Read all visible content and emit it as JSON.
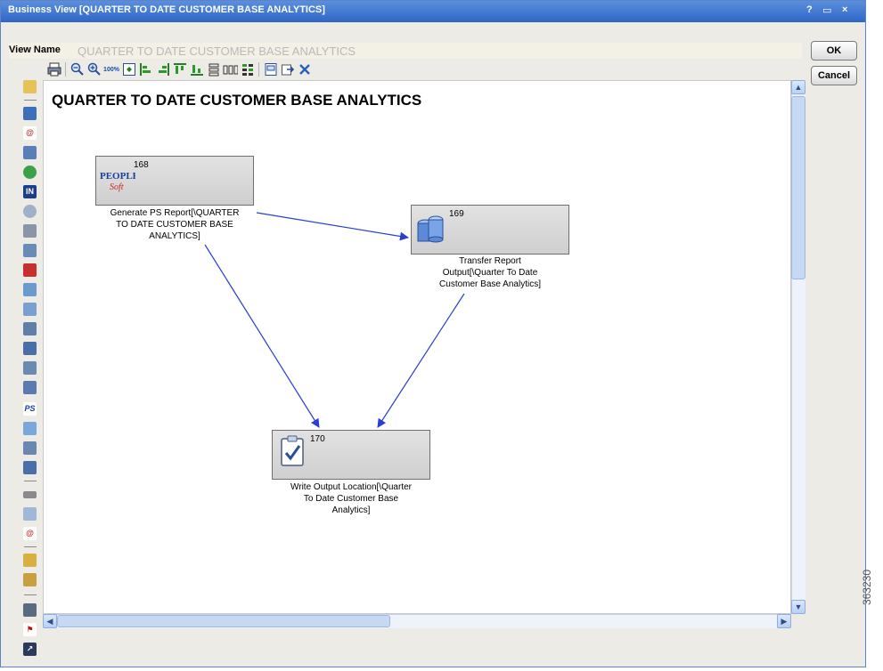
{
  "window": {
    "title": "Business View [QUARTER TO DATE CUSTOMER BASE ANALYTICS]",
    "help_label": "?",
    "restore_label": "▭",
    "close_label": "×"
  },
  "view_name": {
    "label": "View Name",
    "value": "QUARTER TO DATE CUSTOMER BASE ANALYTICS"
  },
  "buttons": {
    "ok": "OK",
    "cancel": "Cancel"
  },
  "toolbar": {
    "items": [
      "print-icon",
      "zoom-out-icon",
      "zoom-in-icon",
      "zoom-100-icon",
      "fit-to-window-icon",
      "align-left-icon",
      "align-right-icon",
      "align-top-icon",
      "align-bottom-icon",
      "distribute-vertical-icon",
      "distribute-horizontal-icon",
      "grid-icon",
      "page-icon",
      "export-icon",
      "delete-icon"
    ],
    "zoom100_label": "100%"
  },
  "canvas": {
    "title": "QUARTER TO DATE CUSTOMER BASE ANALYTICS"
  },
  "nodes": [
    {
      "id": "168",
      "icon": "peoplesoft-icon",
      "label_lines": [
        "Generate PS Report[\\QUARTER",
        "TO DATE CUSTOMER BASE",
        "ANALYTICS]"
      ]
    },
    {
      "id": "169",
      "icon": "transfer-database-icon",
      "label_lines": [
        "Transfer Report",
        "Output[\\Quarter To Date",
        "Customer Base Analytics]"
      ]
    },
    {
      "id": "170",
      "icon": "clipboard-check-icon",
      "label_lines": [
        "Write Output Location[\\Quarter",
        "To Date Customer Base",
        "Analytics]"
      ]
    }
  ],
  "peoplesoft_logo": {
    "top": "PEOPLE",
    "bottom": "Soft"
  },
  "palette_ps_label": "PS",
  "figure_id": "363230",
  "colors": {
    "title_bar": "#2f66c8",
    "edge": "#2a3fd0",
    "node_fill": "#d6d6d6"
  }
}
